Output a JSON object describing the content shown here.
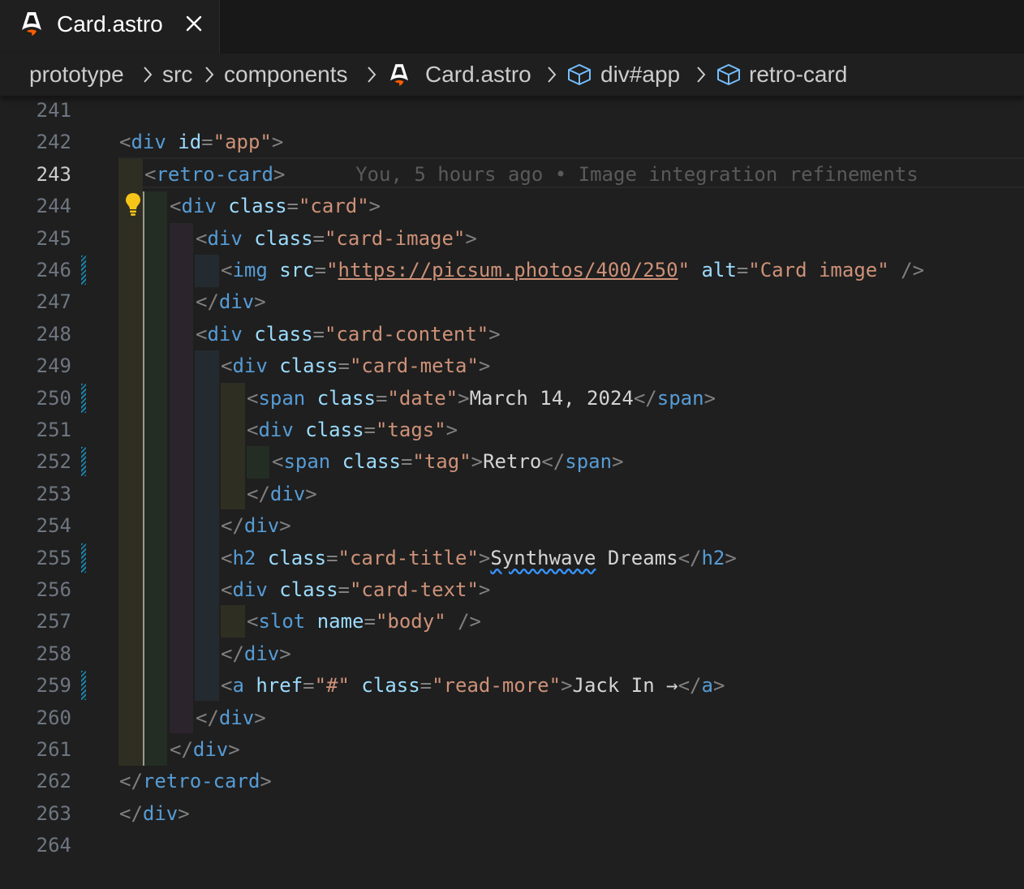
{
  "tab": {
    "label": "Card.astro",
    "icon": "astro-icon",
    "close_icon": "close-icon"
  },
  "breadcrumb": {
    "items": [
      "prototype",
      "src",
      "components",
      "Card.astro",
      "div#app",
      "retro-card"
    ]
  },
  "blame": "You, 5 hours ago • Image integration refinements",
  "line_numbers": [
    "241",
    "242",
    "243",
    "244",
    "245",
    "246",
    "247",
    "248",
    "249",
    "250",
    "251",
    "252",
    "253",
    "254",
    "255",
    "256",
    "257",
    "258",
    "259",
    "260",
    "261",
    "262",
    "263",
    "264"
  ],
  "code": {
    "l242": {
      "open": "<",
      "tag": "div",
      "attr": "id",
      "eq": "=",
      "val": "\"app\"",
      "close": ">"
    },
    "l243": {
      "open": "<",
      "tag": "retro-card",
      "close": ">"
    },
    "l244": {
      "open": "<",
      "tag": "div",
      "attr": "class",
      "eq": "=",
      "val": "\"card\"",
      "close": ">"
    },
    "l245": {
      "open": "<",
      "tag": "div",
      "attr": "class",
      "eq": "=",
      "val": "\"card-image\"",
      "close": ">"
    },
    "l246": {
      "open": "<",
      "tag": "img",
      "attr": "src",
      "eq": "=",
      "q1": "\"",
      "url": "https://picsum.photos/400/250",
      "q2": "\"",
      "attr2": "alt",
      "eq2": "=",
      "val2": "\"Card image\"",
      "close": "/>"
    },
    "l247": {
      "open": "</",
      "tag": "div",
      "close": ">"
    },
    "l248": {
      "open": "<",
      "tag": "div",
      "attr": "class",
      "eq": "=",
      "val": "\"card-content\"",
      "close": ">"
    },
    "l249": {
      "open": "<",
      "tag": "div",
      "attr": "class",
      "eq": "=",
      "val": "\"card-meta\"",
      "close": ">"
    },
    "l250": {
      "open": "<",
      "tag": "span",
      "attr": "class",
      "eq": "=",
      "val": "\"date\"",
      "close": ">",
      "text": "March 14, 2024",
      "end_open": "</",
      "end_tag": "span",
      "end_close": ">"
    },
    "l251": {
      "open": "<",
      "tag": "div",
      "attr": "class",
      "eq": "=",
      "val": "\"tags\"",
      "close": ">"
    },
    "l252": {
      "open": "<",
      "tag": "span",
      "attr": "class",
      "eq": "=",
      "val": "\"tag\"",
      "close": ">",
      "text": "Retro",
      "end_open": "</",
      "end_tag": "span",
      "end_close": ">"
    },
    "l253": {
      "open": "</",
      "tag": "div",
      "close": ">"
    },
    "l254": {
      "open": "</",
      "tag": "div",
      "close": ">"
    },
    "l255": {
      "open": "<",
      "tag": "h2",
      "attr": "class",
      "eq": "=",
      "val": "\"card-title\"",
      "close": ">",
      "text_a": "Synthwave",
      "text_b": " Dreams",
      "end_open": "</",
      "end_tag": "h2",
      "end_close": ">"
    },
    "l256": {
      "open": "<",
      "tag": "div",
      "attr": "class",
      "eq": "=",
      "val": "\"card-text\"",
      "close": ">"
    },
    "l257": {
      "open": "<",
      "tag": "slot",
      "attr": "name",
      "eq": "=",
      "val": "\"body\"",
      "close": "/>"
    },
    "l258": {
      "open": "</",
      "tag": "div",
      "close": ">"
    },
    "l259": {
      "open": "<",
      "tag": "a",
      "attr": "href",
      "eq": "=",
      "val": "\"#\"",
      "attr2": "class",
      "eq2": "=",
      "val2": "\"read-more\"",
      "close": ">",
      "text": "Jack In →",
      "end_open": "</",
      "end_tag": "a",
      "end_close": ">"
    },
    "l260": {
      "open": "</",
      "tag": "div",
      "close": ">"
    },
    "l261": {
      "open": "</",
      "tag": "div",
      "close": ">"
    },
    "l262": {
      "open": "</",
      "tag": "retro-card",
      "close": ">"
    },
    "l263": {
      "open": "</",
      "tag": "div",
      "close": ">"
    }
  },
  "colors": {
    "background": "#1f1f1f",
    "tag": "#569cd6",
    "attribute": "#9cdcfe",
    "string": "#ce9178",
    "punctuation": "#808080",
    "text": "#d4d4d4",
    "modified_gutter": "#1b81a8",
    "lightbulb": "#f5c518"
  }
}
